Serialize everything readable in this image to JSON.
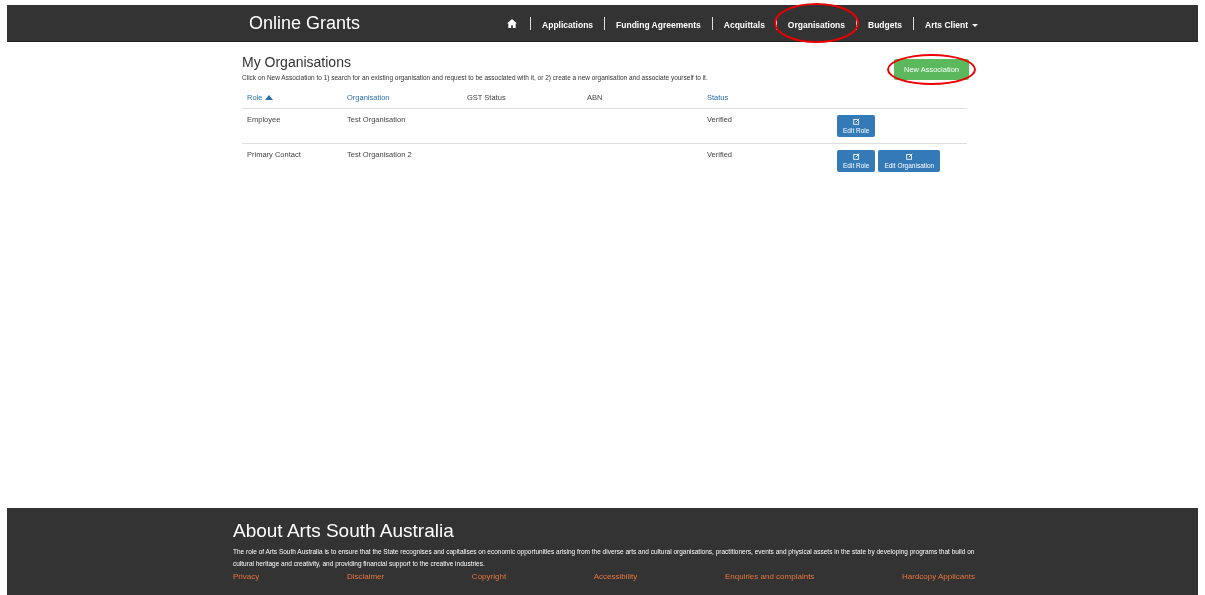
{
  "brand": "Online Grants",
  "nav": [
    {
      "kind": "home"
    },
    {
      "kind": "link",
      "label": "Applications",
      "circled": false
    },
    {
      "kind": "link",
      "label": "Funding Agreements",
      "circled": false
    },
    {
      "kind": "link",
      "label": "Acquittals",
      "circled": false
    },
    {
      "kind": "link",
      "label": "Organisations",
      "circled": true
    },
    {
      "kind": "link",
      "label": "Budgets",
      "circled": false
    },
    {
      "kind": "dropdown",
      "label": "Arts Client",
      "circled": false
    }
  ],
  "page": {
    "title": "My Organisations",
    "description": "Click on New Association to 1) search for an existing organisation and request to be associated with it, or 2) create a new organisation and associate yourself to it.",
    "new_button": {
      "label": "New Association",
      "circled": true
    }
  },
  "table": {
    "columns": [
      {
        "label": "Role",
        "link": true,
        "sorted": true
      },
      {
        "label": "Organisation",
        "link": true,
        "sorted": false
      },
      {
        "label": "GST Status",
        "link": false,
        "sorted": false
      },
      {
        "label": "ABN",
        "link": false,
        "sorted": false
      },
      {
        "label": "Status",
        "link": true,
        "sorted": false
      }
    ],
    "rows": [
      {
        "role": "Employee",
        "organisation": "Test Organisation",
        "status": "Verified",
        "actions": [
          "Edit Role"
        ]
      },
      {
        "role": "Primary Contact",
        "organisation": "Test Organisation 2",
        "status": "Verified",
        "actions": [
          "Edit Role",
          "Edit Organisation"
        ]
      }
    ]
  },
  "footer": {
    "title": "About Arts South Australia",
    "text": "The role of Arts South Australia is to ensure that the State recognises and capitalises on economic opportunities arising from the diverse arts and cultural organisations, practitioners, events and physical assets in the state by developing programs that build on cultural heritage and creativity, and providing financial support to the creative industries.",
    "links": [
      "Privacy",
      "Disclaimer",
      "Copyright",
      "Accessibility",
      "Enquiries and complaints",
      "Hardcopy Applicants"
    ]
  }
}
